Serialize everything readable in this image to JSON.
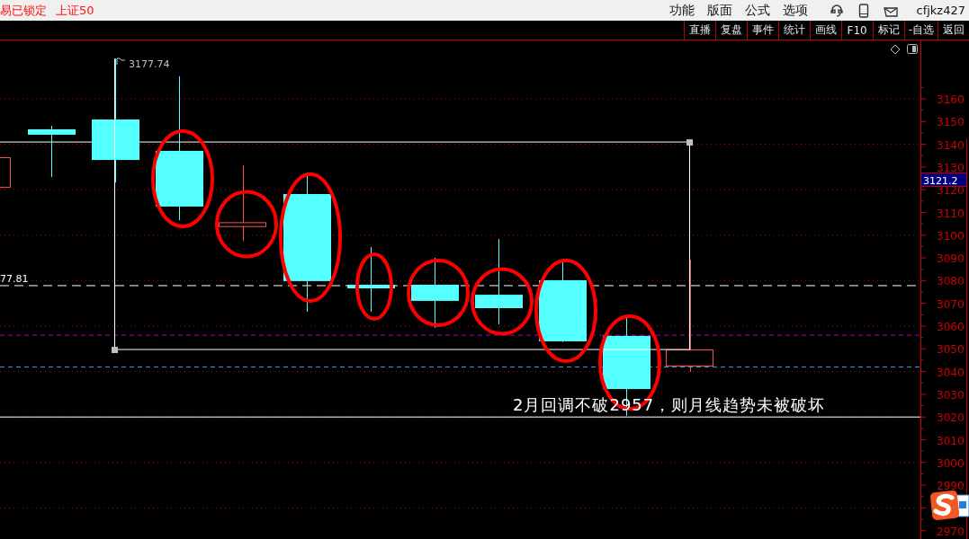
{
  "top_bar": {
    "status": "易已锁定",
    "index_name": "上证50",
    "menu": [
      "功能",
      "版面",
      "公式",
      "选项"
    ],
    "user": "cfjkz427"
  },
  "toolbar": {
    "buttons": [
      "直播",
      "复盘",
      "事件",
      "统计",
      "画线",
      "F10",
      "标记",
      "-自选",
      "返回"
    ]
  },
  "chart": {
    "axis_labels": [
      "3160",
      "3150",
      "3140",
      "3130",
      "3120",
      "3110",
      "3100",
      "3090",
      "3080",
      "3070",
      "3060",
      "3050",
      "3040",
      "3030",
      "3020",
      "3010",
      "3000",
      "2990",
      "2970"
    ],
    "candles": [
      {
        "circled": false
      },
      {
        "circled": false
      },
      {
        "circled": false
      },
      {
        "circled": true
      },
      {
        "circled": true
      },
      {
        "circled": true
      },
      {
        "circled": true
      },
      {
        "circled": true
      },
      {
        "circled": true
      },
      {
        "circled": true
      },
      {
        "circled": true
      },
      {
        "circled": false
      }
    ],
    "high_label": "3177.74",
    "line_label": "77.81",
    "price_tag": "3121.2",
    "note": "2月回调不破2957，则月线趋势未被破坏"
  }
}
